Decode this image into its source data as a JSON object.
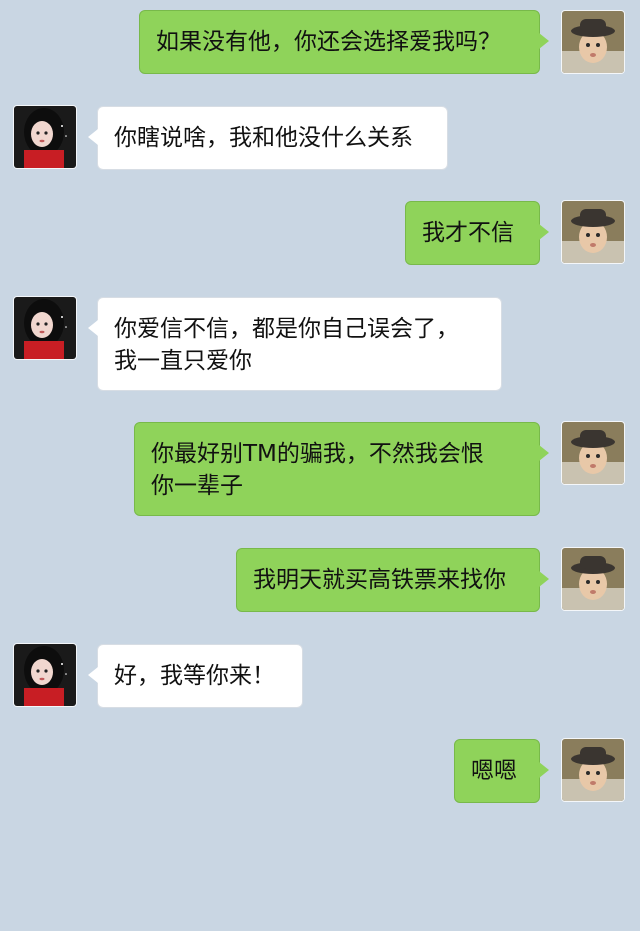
{
  "conversation": {
    "messages": [
      {
        "side": "right",
        "avatar": "boy-avatar",
        "text": "如果没有他，你还会选择爱我吗？"
      },
      {
        "side": "left",
        "avatar": "girl-avatar",
        "text": "你瞎说啥，我和他没什么关系"
      },
      {
        "side": "right",
        "avatar": "boy-avatar",
        "text": "我才不信"
      },
      {
        "side": "left",
        "avatar": "girl-avatar",
        "lines": [
          "你爱信不信，都是你自己误会了，",
          "我一直只爱你"
        ]
      },
      {
        "side": "right",
        "avatar": "boy-avatar",
        "lines": [
          "你最好别TM的骗我，不然我会恨",
          "你一辈子"
        ]
      },
      {
        "side": "right",
        "avatar": "boy-avatar",
        "text": "我明天就买高铁票来找你"
      },
      {
        "side": "left",
        "avatar": "girl-avatar",
        "text": "好，我等你来！"
      },
      {
        "side": "right",
        "avatar": "boy-avatar",
        "text": "嗯嗯"
      }
    ]
  },
  "colors": {
    "background": "#c9d6e3",
    "sent_bubble": "#8fd35a",
    "received_bubble": "#ffffff"
  }
}
